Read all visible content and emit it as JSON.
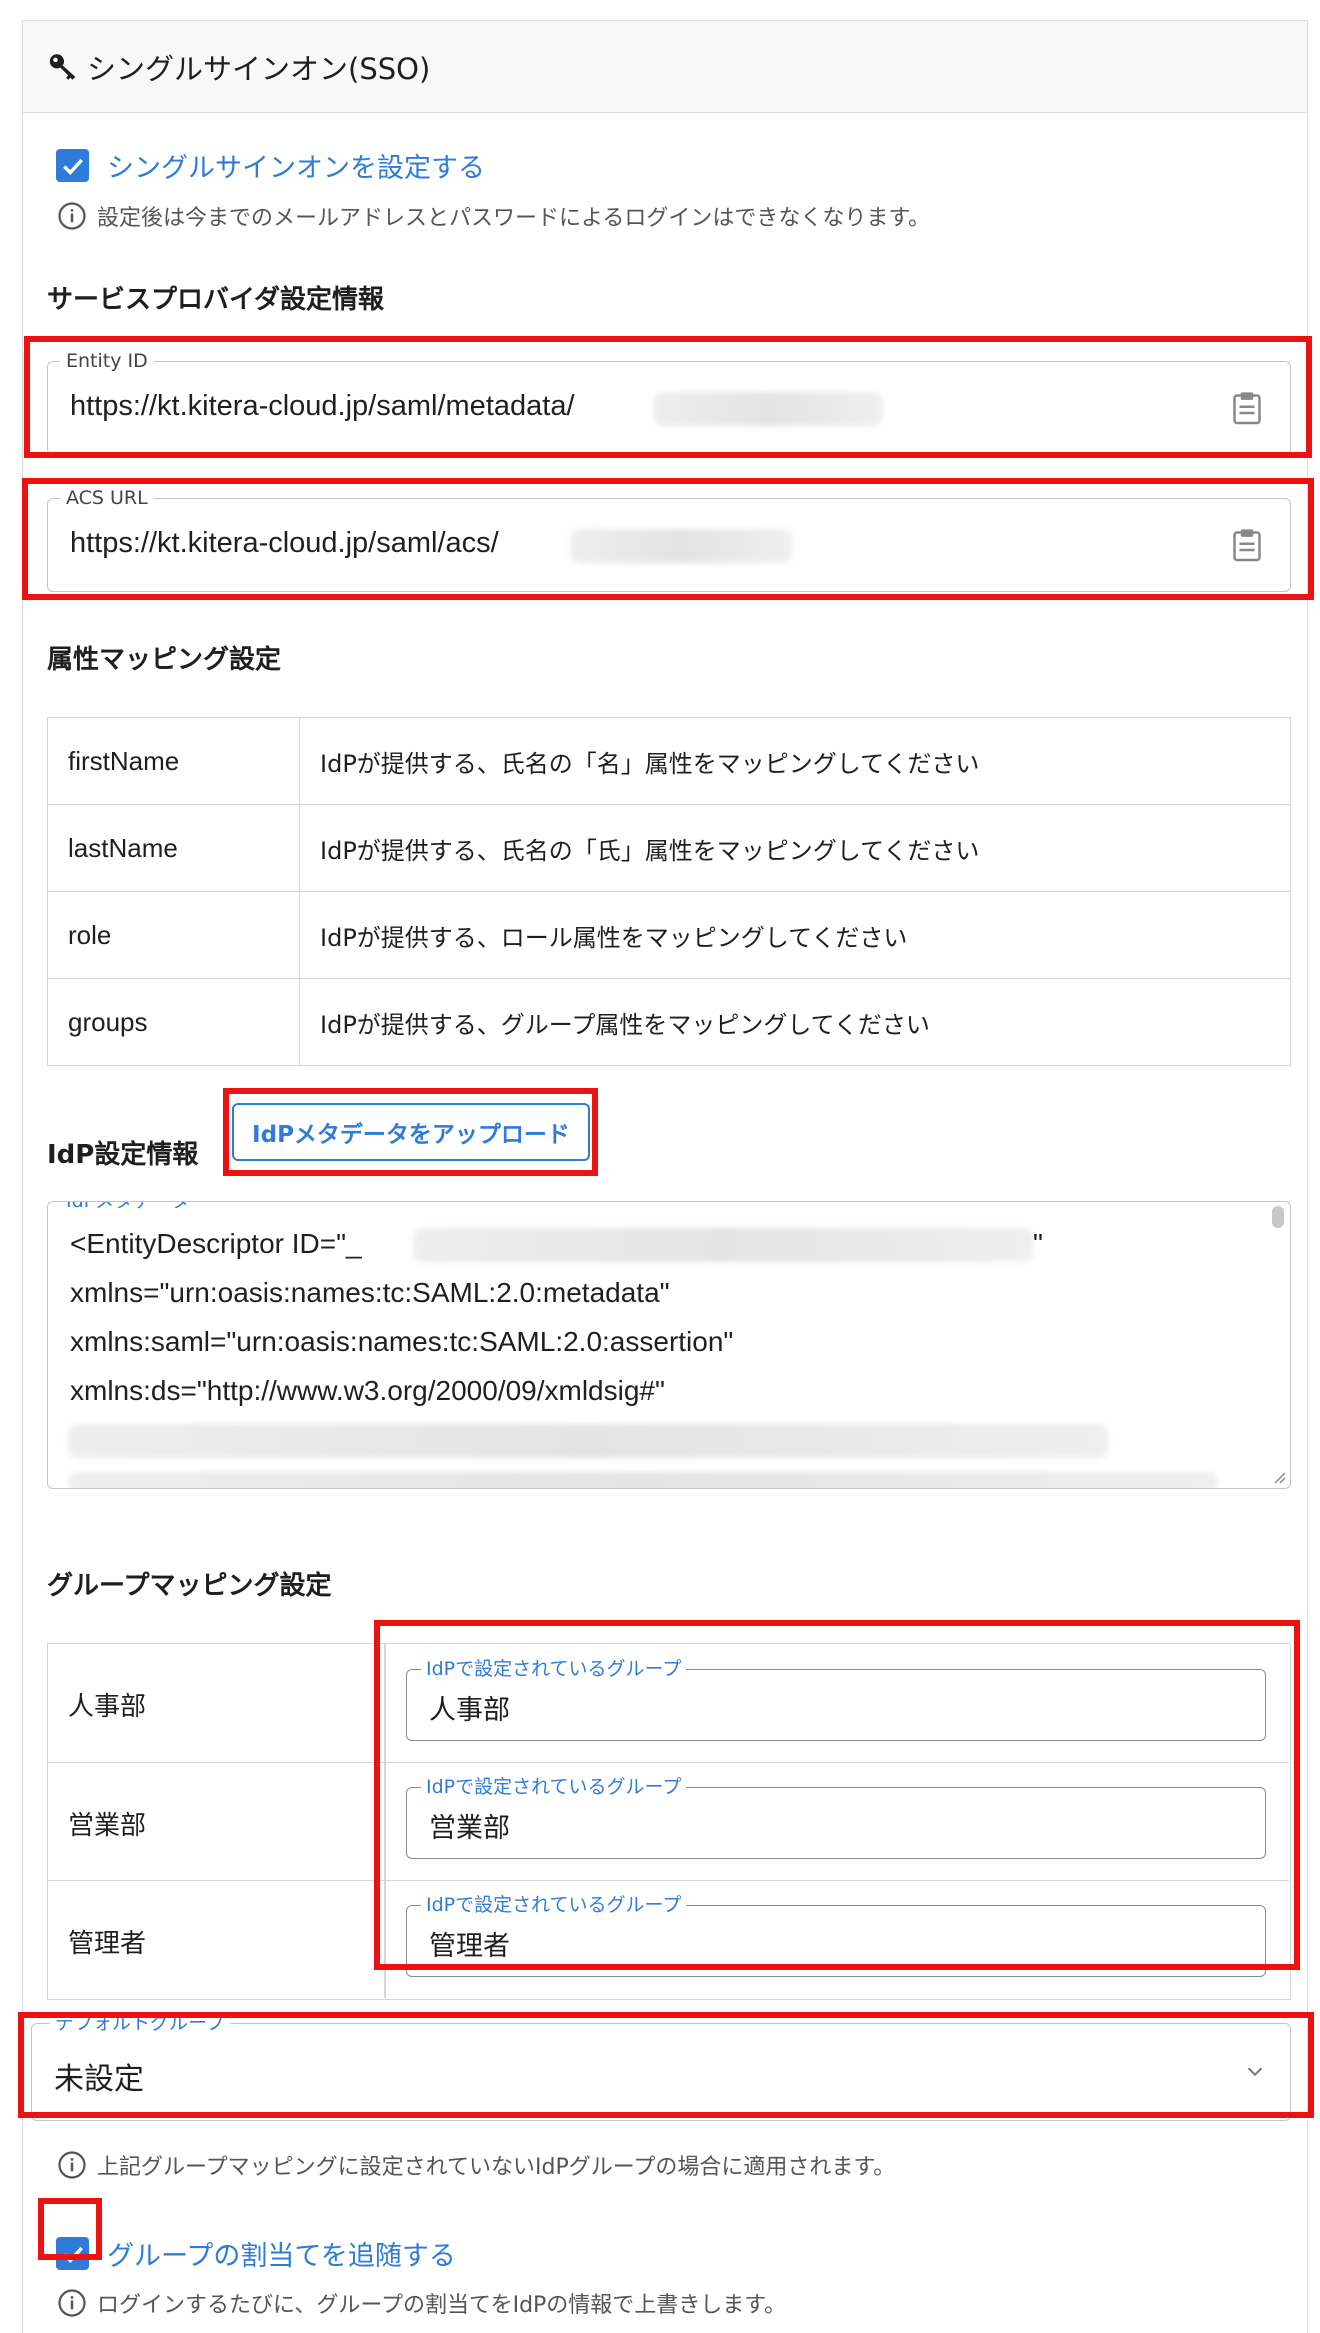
{
  "header": {
    "title": "シングルサインオン(SSO)",
    "icon": "key-icon"
  },
  "sso_toggle": {
    "label": "シングルサインオンを設定する",
    "checked": true,
    "note": "設定後は今までのメールアドレスとパスワードによるログインはできなくなります。"
  },
  "service_provider": {
    "title": "サービスプロバイダ設定情報",
    "entity_id": {
      "label": "Entity ID",
      "value": "https://kt.kitera-cloud.jp/saml/metadata/"
    },
    "acs_url": {
      "label": "ACS URL",
      "value": "https://kt.kitera-cloud.jp/saml/acs/"
    }
  },
  "attribute_mapping": {
    "title": "属性マッピング設定",
    "rows": [
      {
        "key": "firstName",
        "desc": "IdPが提供する、氏名の「名」属性をマッピングしてください"
      },
      {
        "key": "lastName",
        "desc": "IdPが提供する、氏名の「氏」属性をマッピングしてください"
      },
      {
        "key": "role",
        "desc": "IdPが提供する、ロール属性をマッピングしてください"
      },
      {
        "key": "groups",
        "desc": "IdPが提供する、グループ属性をマッピングしてください"
      }
    ]
  },
  "idp": {
    "title": "IdP設定情報",
    "upload_button": "IdPメタデータをアップロード",
    "metadata_label": "IdPメタデータ",
    "metadata_lines": [
      "<EntityDescriptor ID=\"_",
      "xmlns=\"urn:oasis:names:tc:SAML:2.0:metadata\"",
      "xmlns:saml=\"urn:oasis:names:tc:SAML:2.0:assertion\"",
      "xmlns:ds=\"http://www.w3.org/2000/09/xmldsig#\""
    ],
    "metadata_quote_end": "\""
  },
  "group_mapping": {
    "title": "グループマッピング設定",
    "field_label": "IdPで設定されているグループ",
    "rows": [
      {
        "name": "人事部",
        "value": "人事部"
      },
      {
        "name": "営業部",
        "value": "営業部"
      },
      {
        "name": "管理者",
        "value": "管理者"
      }
    ]
  },
  "default_group": {
    "label": "デフォルトグループ",
    "value": "未設定",
    "note": "上記グループマッピングに設定されていないIdPグループの場合に適用されます。"
  },
  "follow_group": {
    "label": "グループの割当てを追随する",
    "checked": true,
    "note": "ログインするたびに、グループの割当てをIdPの情報で上書きします。"
  },
  "colors": {
    "accent": "#2f7bd9",
    "highlight": "#ee1111"
  }
}
